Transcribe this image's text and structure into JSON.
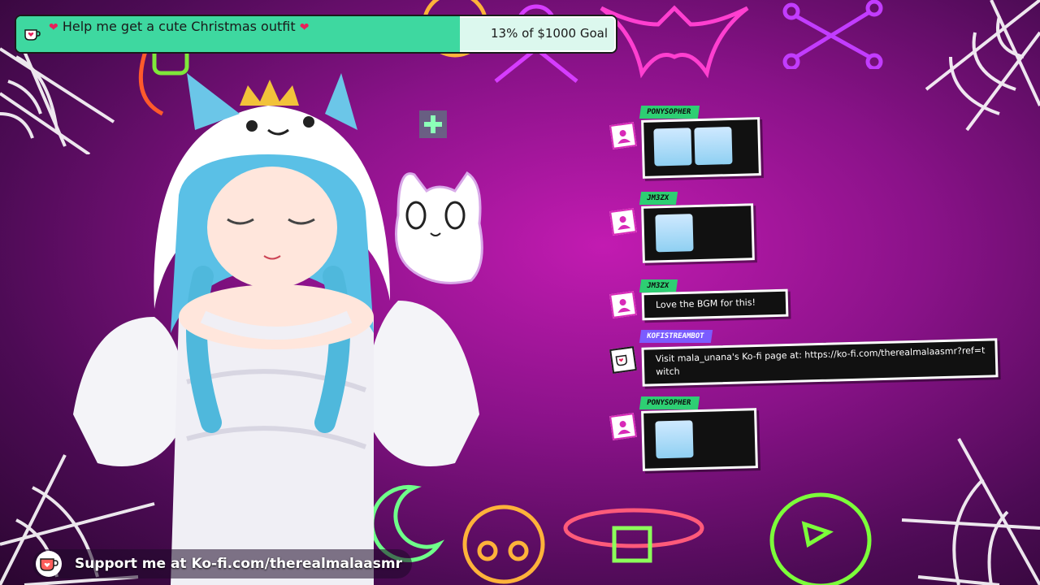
{
  "goal": {
    "title": "Help me get a cute Christmas outfit",
    "progress_text": "13% of $1000 Goal",
    "progress_fraction": 0.13,
    "icon": "ko-fi-cup-icon",
    "heart_icon": "heart-icon"
  },
  "chat": {
    "messages": [
      {
        "user": "PONYSOPHER",
        "type": "emotes",
        "emotes": [
          "vtuber-emote-1",
          "vtuber-emote-2"
        ],
        "tag_color": "#2ecf73"
      },
      {
        "user": "JM3ZX",
        "type": "emotes",
        "emotes": [
          "vtuber-emote-3"
        ],
        "tag_color": "#2ecf73"
      },
      {
        "user": "JM3ZX",
        "type": "text",
        "text": "Love the BGM for this!",
        "tag_color": "#2ecf73"
      },
      {
        "user": "KOFISTREAMBOT",
        "type": "text",
        "text": "Visit mala_unana's Ko-fi page at: https://ko-fi.com/therealmalaasmr?ref=twitch",
        "tag_color": "#7b5cff"
      },
      {
        "user": "PONYSOPHER",
        "type": "emotes",
        "emotes": [
          "vtuber-emote-4"
        ],
        "tag_color": "#2ecf73"
      }
    ]
  },
  "support": {
    "text": "Support me at Ko-fi.com/therealmalaasmr",
    "icon": "ko-fi-cup-icon"
  },
  "colors": {
    "accent": "#3ed8a0",
    "chat_border": "#d82ab8",
    "bot_tag": "#7b5cff",
    "user_tag": "#2ecf73"
  }
}
